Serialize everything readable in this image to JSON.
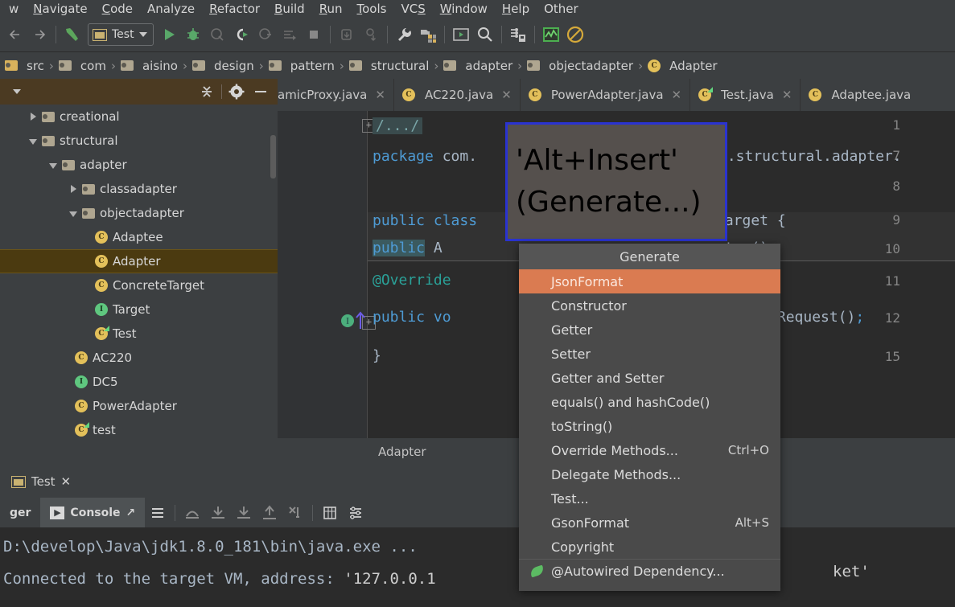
{
  "menubar": {
    "items": [
      {
        "label": "w",
        "mnemonic": ""
      },
      {
        "label": "Navigate",
        "mnemonic": "N"
      },
      {
        "label": "Code",
        "mnemonic": "C"
      },
      {
        "label": "Analyze",
        "mnemonic": ""
      },
      {
        "label": "Refactor",
        "mnemonic": "R"
      },
      {
        "label": "Build",
        "mnemonic": "B"
      },
      {
        "label": "Run",
        "mnemonic": "R"
      },
      {
        "label": "Tools",
        "mnemonic": "T"
      },
      {
        "label": "VCS",
        "mnemonic": "S"
      },
      {
        "label": "Window",
        "mnemonic": "W"
      },
      {
        "label": "Help",
        "mnemonic": "H"
      },
      {
        "label": "Other",
        "mnemonic": ""
      }
    ]
  },
  "toolbar": {
    "back_label": "Back",
    "forward_label": "Forward",
    "build_label": "Build Project",
    "run_config_name": "Test",
    "run_label": "Run",
    "debug_label": "Debug",
    "run_coverage_label": "Run with Coverage",
    "profile_label": "Profile",
    "attach_label": "Attach to Process",
    "stop_label": "Stop",
    "update_label": "Update Project",
    "commit_label": "Commit",
    "settings_label": "Settings",
    "project_structure_label": "Project Structure",
    "sdk_label": "SDK",
    "search_label": "Search Everywhere",
    "db_label": "Database",
    "chart_label": "Monitor",
    "noentry_label": "Mute Breakpoints"
  },
  "navbar": {
    "crumbs": [
      {
        "label": "src",
        "icon": "folder-src-icon"
      },
      {
        "label": "com",
        "icon": "folder-icon"
      },
      {
        "label": "aisino",
        "icon": "folder-icon"
      },
      {
        "label": "design",
        "icon": "folder-icon"
      },
      {
        "label": "pattern",
        "icon": "folder-icon"
      },
      {
        "label": "structural",
        "icon": "folder-icon"
      },
      {
        "label": "adapter",
        "icon": "folder-icon"
      },
      {
        "label": "objectadapter",
        "icon": "folder-icon"
      },
      {
        "label": "Adapter",
        "icon": "class-icon"
      }
    ],
    "separator": "›"
  },
  "project_panel": {
    "collapse_all_label": "Collapse All",
    "settings_label": "Settings",
    "hide_label": "Hide",
    "tree": [
      {
        "label": "creational",
        "indent": 1,
        "toggle": "right",
        "icon": "folder"
      },
      {
        "label": "structural",
        "indent": 1,
        "toggle": "down",
        "icon": "folder"
      },
      {
        "label": "adapter",
        "indent": 2,
        "toggle": "down",
        "icon": "folder"
      },
      {
        "label": "classadapter",
        "indent": 3,
        "toggle": "right",
        "icon": "folder"
      },
      {
        "label": "objectadapter",
        "indent": 3,
        "toggle": "down",
        "icon": "folder"
      },
      {
        "label": "Adaptee",
        "indent": 4,
        "toggle": "none",
        "icon": "class"
      },
      {
        "label": "Adapter",
        "indent": 4,
        "toggle": "none",
        "icon": "class",
        "selected": true
      },
      {
        "label": "ConcreteTarget",
        "indent": 4,
        "toggle": "none",
        "icon": "class"
      },
      {
        "label": "Target",
        "indent": 4,
        "toggle": "none",
        "icon": "interface"
      },
      {
        "label": "Test",
        "indent": 4,
        "toggle": "none",
        "icon": "class-runnable"
      },
      {
        "label": "AC220",
        "indent": 3,
        "toggle": "none",
        "icon": "class"
      },
      {
        "label": "DC5",
        "indent": 3,
        "toggle": "none",
        "icon": "interface"
      },
      {
        "label": "PowerAdapter",
        "indent": 3,
        "toggle": "none",
        "icon": "class"
      },
      {
        "label": "test",
        "indent": 3,
        "toggle": "none",
        "icon": "class-runnable"
      }
    ]
  },
  "editor_tabs": [
    {
      "label": "amicProxy.java",
      "icon": "class-icon",
      "closable": true,
      "clipped_left": true
    },
    {
      "label": "AC220.java",
      "icon": "class-icon",
      "closable": true
    },
    {
      "label": "PowerAdapter.java",
      "icon": "class-icon",
      "closable": true
    },
    {
      "label": "Test.java",
      "icon": "class-runnable-icon",
      "closable": true
    },
    {
      "label": "Adaptee.java",
      "icon": "class-icon",
      "closable": false,
      "clipped_right": true
    }
  ],
  "editor": {
    "line_numbers": [
      "1",
      "7",
      "8",
      "9",
      "10",
      "11",
      "12",
      "15"
    ],
    "fold_collapsed_text": "/.../",
    "lines": [
      {
        "num": "1",
        "text": "/.../",
        "kind": "folded-comment"
      },
      {
        "num": "7",
        "text": "package com.aisino.design.pattern.structural.adapter.objectadapter;",
        "kind": "package"
      },
      {
        "num": "8",
        "text": "",
        "kind": "blank"
      },
      {
        "num": "9",
        "text": "public class Adapter implements Target {",
        "kind": "code"
      },
      {
        "num": "10",
        "text": "    public Adaptee adaptee = new Adaptee();",
        "kind": "code"
      },
      {
        "num": "11",
        "text": "    @Override",
        "kind": "annotation"
      },
      {
        "num": "12",
        "text": "    public void request() { adaptee.adapteeRequest();",
        "kind": "code"
      },
      {
        "num": "15",
        "text": "}",
        "kind": "code"
      }
    ],
    "visible_code_fragments": {
      "l7_kw": "package",
      "l7_rest": "com.",
      "l7_tail": "n.structural.adapter.",
      "l9_kw": "public class",
      "l9_tail": "Target {",
      "l10_kw": "public",
      "l10_a": "A",
      "l10_tail": "ptee()",
      "l11": "@Override",
      "l12_kw": "public vo",
      "l12_tail": "adapteeRequest()",
      "l15": "}"
    },
    "breadcrumb": "Adapter"
  },
  "callout": {
    "line1": "'Alt+Insert'",
    "line2": "(Generate...)",
    "border_color": "#2a33d0",
    "bg_color": "#55504d"
  },
  "generate_popup": {
    "title": "Generate",
    "highlight_color": "#da7b51",
    "items": [
      {
        "label": "JsonFormat",
        "shortcut": "",
        "highlighted": true
      },
      {
        "label": "Constructor",
        "shortcut": ""
      },
      {
        "label": "Getter",
        "shortcut": ""
      },
      {
        "label": "Setter",
        "shortcut": ""
      },
      {
        "label": "Getter and Setter",
        "shortcut": ""
      },
      {
        "label": "equals() and hashCode()",
        "shortcut": ""
      },
      {
        "label": "toString()",
        "shortcut": ""
      },
      {
        "label": "Override Methods...",
        "shortcut": "Ctrl+O"
      },
      {
        "label": "Delegate Methods...",
        "shortcut": ""
      },
      {
        "label": "Test...",
        "shortcut": ""
      },
      {
        "label": "GsonFormat",
        "shortcut": "Alt+S"
      },
      {
        "label": "Copyright",
        "shortcut": ""
      },
      {
        "label": "@Autowired Dependency...",
        "shortcut": "",
        "icon": "spring-leaf-icon",
        "separated": true
      }
    ]
  },
  "tool_window": {
    "tab_label": "Test",
    "tab_close": "×",
    "debugger_label": "ger",
    "console_label": "Console",
    "icons": [
      "list-icon",
      "step-over-icon",
      "step-into-icon",
      "force-step-into-icon",
      "step-out-icon",
      "run-to-cursor-icon",
      "evaluate-icon",
      "settings-icon"
    ]
  },
  "console": {
    "line1": "D:\\develop\\Java\\jdk1.8.0_181\\bin\\java.exe ...",
    "line2_prefix": "Connected to the target VM, address: ",
    "line2_addr": "'127.0.0.1",
    "line2_suffix": "ket'"
  }
}
